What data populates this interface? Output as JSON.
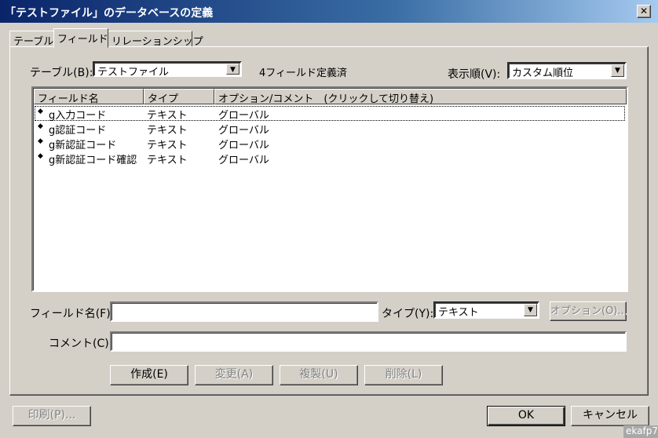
{
  "window": {
    "title": "「テストファイル」のデータベースの定義",
    "close_label": "✕"
  },
  "tabs": [
    {
      "label": "テーブル"
    },
    {
      "label": "フィールド"
    },
    {
      "label": "リレーションシップ"
    }
  ],
  "table_select": {
    "label": "テーブル(B):",
    "value": "テストファイル"
  },
  "field_count": "4フィールド定義済",
  "sort_select": {
    "label": "表示順(V):",
    "value": "カスタム順位"
  },
  "list": {
    "columns": [
      "フィールド名",
      "タイプ",
      "オプション/コメント　(クリックして切り替え)"
    ],
    "rows": [
      {
        "name": "g入力コード",
        "type": "テキスト",
        "options": "グローバル"
      },
      {
        "name": "g認証コード",
        "type": "テキスト",
        "options": "グローバル"
      },
      {
        "name": "g新認証コード",
        "type": "テキスト",
        "options": "グローバル"
      },
      {
        "name": "g新認証コード確認",
        "type": "テキスト",
        "options": "グローバル"
      }
    ]
  },
  "field_name": {
    "label": "フィールド名(F):",
    "value": ""
  },
  "type_select": {
    "label": "タイプ(Y):",
    "value": "テキスト"
  },
  "options_button": "オプション(O)...",
  "comment": {
    "label": "コメント(C):",
    "value": ""
  },
  "actions": {
    "create": "作成(E)",
    "change": "変更(A)",
    "duplicate": "複製(U)",
    "delete": "削除(L)"
  },
  "footer": {
    "print": "印刷(P)...",
    "ok": "OK",
    "cancel": "キャンセル"
  },
  "watermark": "ekafp7"
}
